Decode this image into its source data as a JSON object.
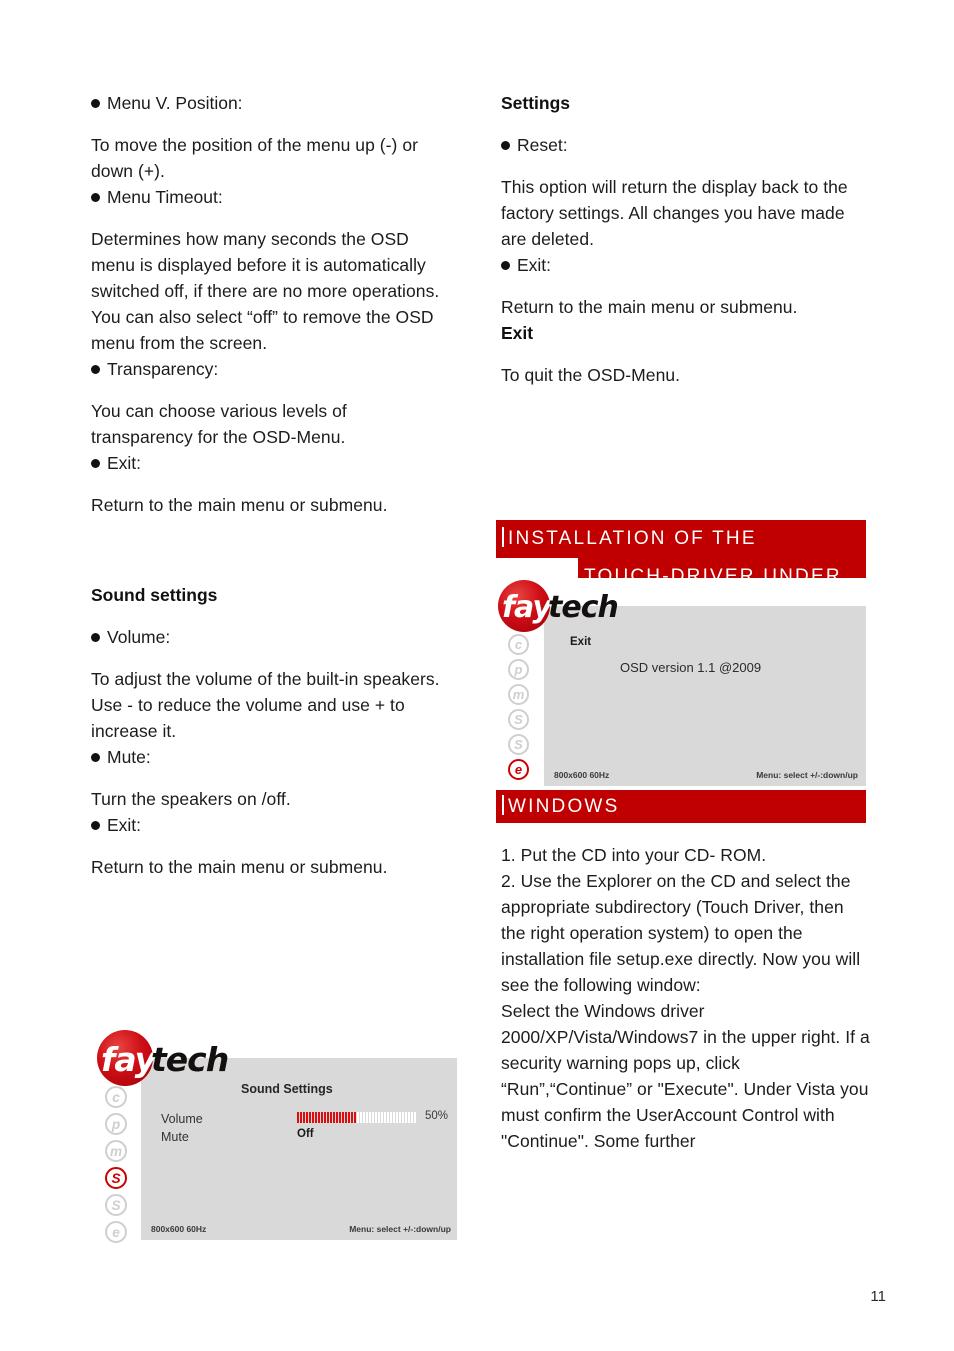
{
  "page": {
    "number": "11"
  },
  "colors": {
    "banner_red": "#C00000",
    "osd_gray": "#d9d9d9",
    "accent_red": "#cc0000",
    "bar_red": "#d81010"
  },
  "left_column": {
    "blocks": [
      {
        "type": "bullet",
        "text": "Menu V. Position:"
      },
      {
        "type": "para",
        "text": "To move the position of the menu up (-) or down (+)."
      },
      {
        "type": "bullet",
        "text": "Menu Timeout:"
      },
      {
        "type": "para",
        "text": "Determines how many seconds the OSD menu is displayed before it is automatically switched off, if there are no more operations. You can also select “off” to remove the OSD menu from the screen."
      },
      {
        "type": "bullet",
        "text": "Transparency:"
      },
      {
        "type": "para",
        "text": "You can choose various levels of transparency for the OSD-Menu."
      },
      {
        "type": "bullet",
        "text": "Exit:"
      },
      {
        "type": "para",
        "text": "Return to the main menu or submenu."
      },
      {
        "type": "heading",
        "text": "Sound settings"
      },
      {
        "type": "bullet",
        "text": "Volume:"
      },
      {
        "type": "para",
        "text": "To adjust the volume of the built-in speakers. Use - to reduce the volume and use + to increase it."
      },
      {
        "type": "bullet",
        "text": "Mute:"
      },
      {
        "type": "para",
        "text": "Turn the speakers on /off."
      },
      {
        "type": "bullet",
        "text": "Exit:"
      },
      {
        "type": "para",
        "text": "Return to the main menu or submenu."
      }
    ]
  },
  "right_column": {
    "blocks": [
      {
        "type": "heading",
        "text": "Settings"
      },
      {
        "type": "bullet",
        "text": "Reset:"
      },
      {
        "type": "para",
        "text": "This option will return the display back to the factory settings. All changes you have made are deleted."
      },
      {
        "type": "bullet",
        "text": "Exit:"
      },
      {
        "type": "para",
        "text": "Return to the main menu or submenu."
      },
      {
        "type": "heading",
        "text": "Exit"
      },
      {
        "type": "para",
        "text": "To quit the OSD-Menu."
      }
    ],
    "steps": [
      "1. Put the CD into your CD- ROM.",
      "2. Use the Explorer on the CD and select the appropriate subdirectory (Touch Driver, then the right operation system) to open the installation file setup.exe directly. Now you will see the following window:",
      "Select the Windows driver 2000/XP/Vista/Windows7 in the upper right. If a security warning pops up, click “Run”,“Continue” or \"Execute\". Under Vista you must confirm the UserAccount Control with \"Continue\". Some further"
    ]
  },
  "section_banner": {
    "line1": "INSTALLATION OF THE",
    "line2": "TOUCH-DRIVER UNDER",
    "line3": "WINDOWS"
  },
  "osd_sound": {
    "logo": {
      "red_text": "fay",
      "black_text": "tech"
    },
    "rail": [
      {
        "letter": "c",
        "active": false
      },
      {
        "letter": "p",
        "active": false
      },
      {
        "letter": "m",
        "active": false
      },
      {
        "letter": "S",
        "active": true
      },
      {
        "letter": "S",
        "active": false
      },
      {
        "letter": "e",
        "active": false
      }
    ],
    "title": "Sound Settings",
    "rows": [
      {
        "label": "Volume",
        "value": "50%"
      },
      {
        "label": "Mute",
        "value": "Off"
      }
    ],
    "volume_percent": 50,
    "footer_left": "800x600 60Hz",
    "footer_right": "Menu: select +/-:down/up"
  },
  "osd_exit": {
    "logo": {
      "red_text": "fay",
      "black_text": "tech"
    },
    "rail": [
      {
        "letter": "c",
        "active": false
      },
      {
        "letter": "p",
        "active": false
      },
      {
        "letter": "m",
        "active": false
      },
      {
        "letter": "S",
        "active": false
      },
      {
        "letter": "S",
        "active": false
      },
      {
        "letter": "e",
        "active": true
      }
    ],
    "title": "Exit",
    "version": "OSD version 1.1 @2009",
    "footer_left": "800x600 60Hz",
    "footer_right": "Menu: select +/-:down/up"
  }
}
